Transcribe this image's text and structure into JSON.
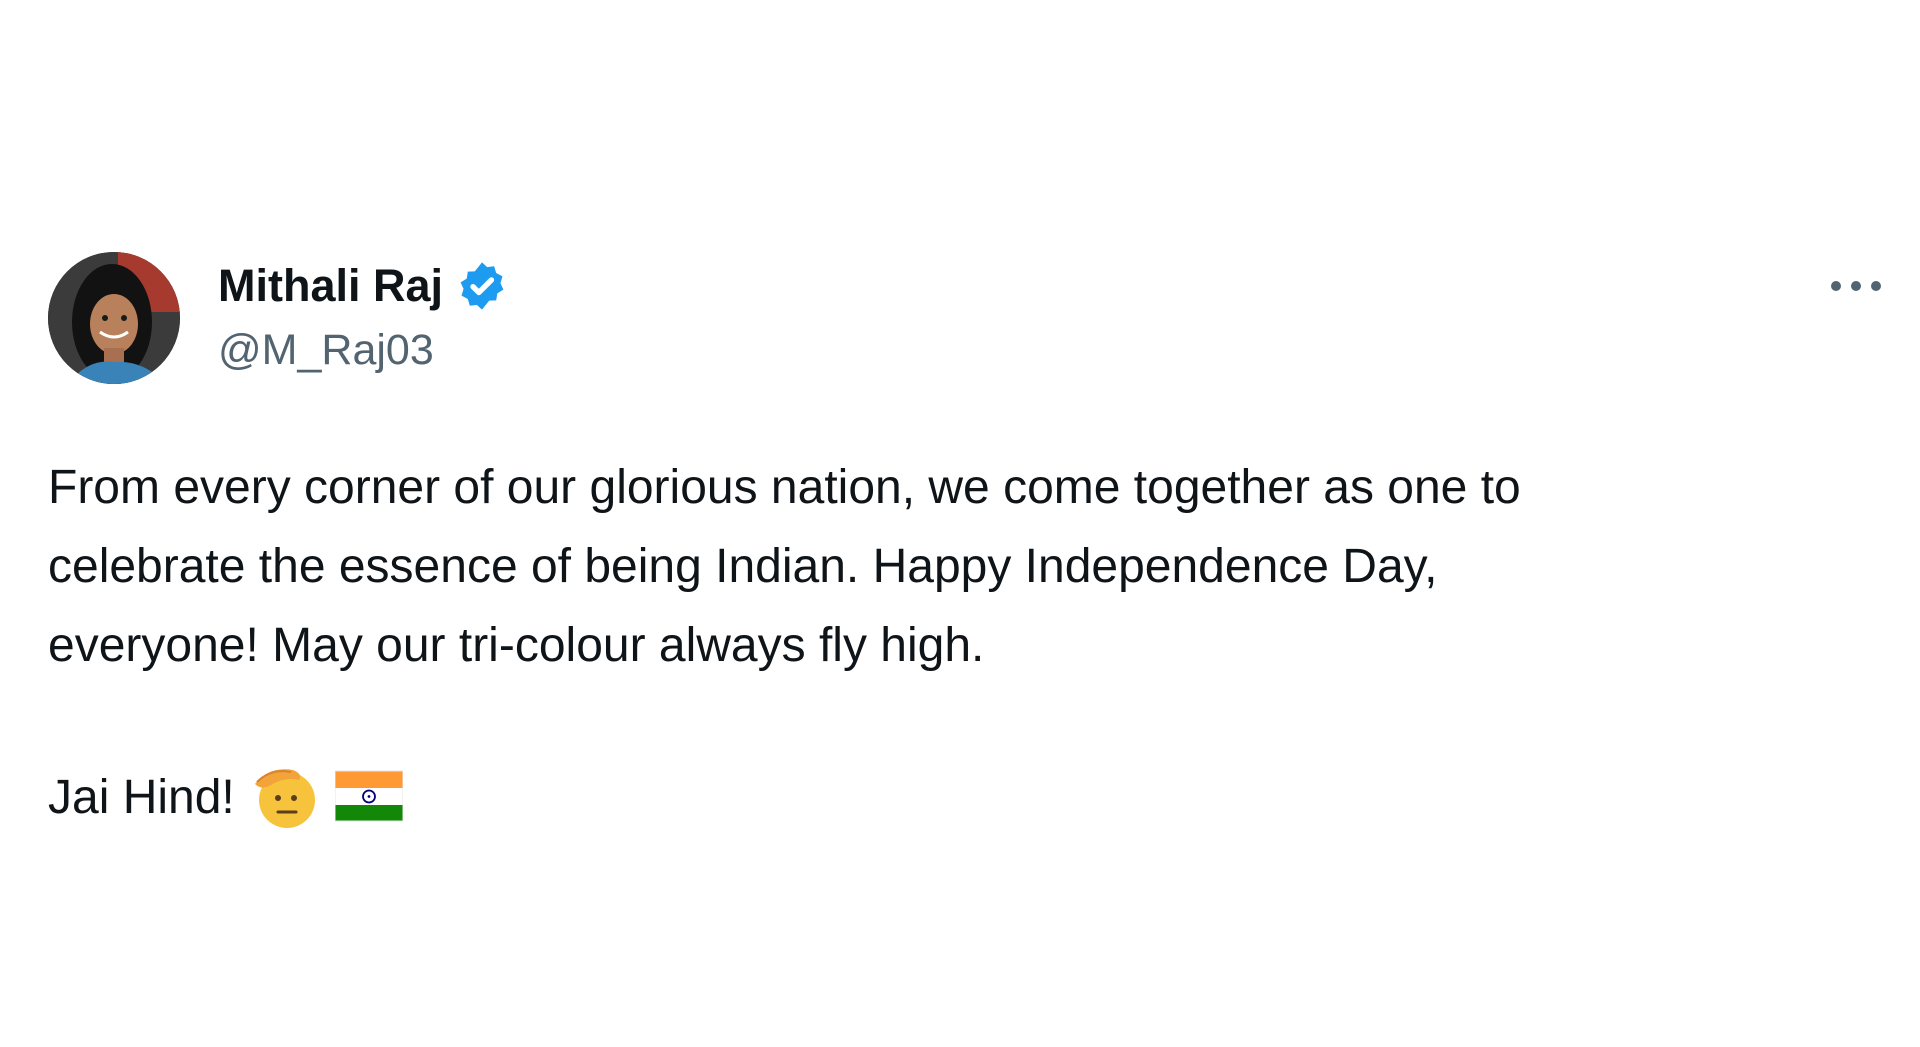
{
  "tweet": {
    "author": {
      "display_name": "Mithali Raj",
      "handle": "@M_Raj03",
      "verified": true,
      "avatar_icon": "profile-photo"
    },
    "more_icon": "more-horizontal-icon",
    "body": "From every corner of our glorious nation, we come together as one to\ncelebrate the essence of being Indian. Happy Independence Day,\neveryone! May our tri-colour always fly high.",
    "closing_line": "Jai Hind!",
    "emojis": [
      "saluting-face-emoji",
      "india-flag-emoji"
    ]
  },
  "colors": {
    "text_primary": "#0f1419",
    "text_secondary": "#536471",
    "verified_blue": "#1d9bf0",
    "flag_saffron": "#ff9933",
    "flag_white": "#ffffff",
    "flag_green": "#138808",
    "flag_chakra": "#000080"
  }
}
